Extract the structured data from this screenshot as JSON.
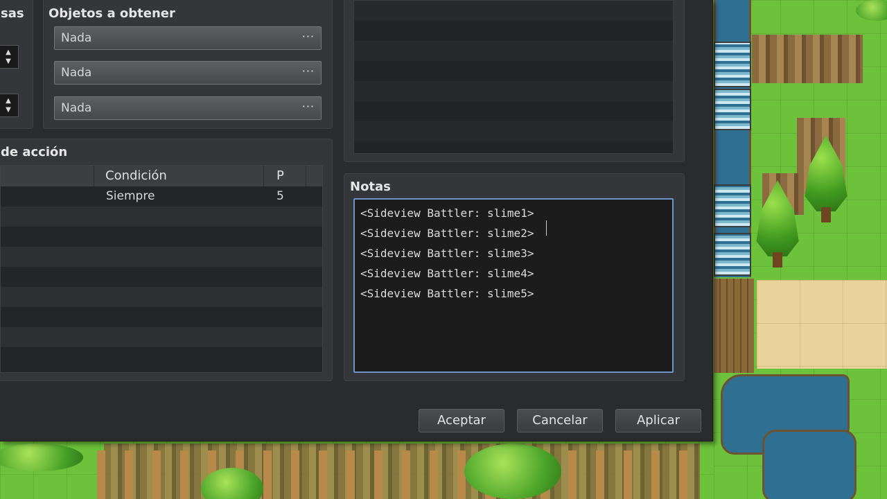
{
  "left_panel": {
    "header_partial": "sas",
    "items_title": "Objetos a obtener",
    "items": [
      "Nada",
      "Nada",
      "Nada"
    ],
    "item_button_glyph": "···",
    "spin_up": "▲",
    "spin_down": "▼"
  },
  "actions": {
    "title_partial": "de acción",
    "columns": [
      "Condición",
      "P"
    ],
    "rows": [
      {
        "condition": "Siempre",
        "priority": "5"
      }
    ]
  },
  "notes": {
    "title": "Notas",
    "lines": [
      "<Sideview Battler: slime1>",
      "<Sideview Battler: slime2>",
      "<Sideview Battler: slime3>",
      "<Sideview Battler: slime4>",
      "<Sideview Battler: slime5>"
    ]
  },
  "buttons": {
    "ok": "Aceptar",
    "cancel": "Cancelar",
    "apply": "Aplicar"
  },
  "colors": {
    "window_bg": "#2a2b2d",
    "focus_border": "#6d93c9",
    "grass": "#6cc23a",
    "water": "#2f6f92"
  }
}
